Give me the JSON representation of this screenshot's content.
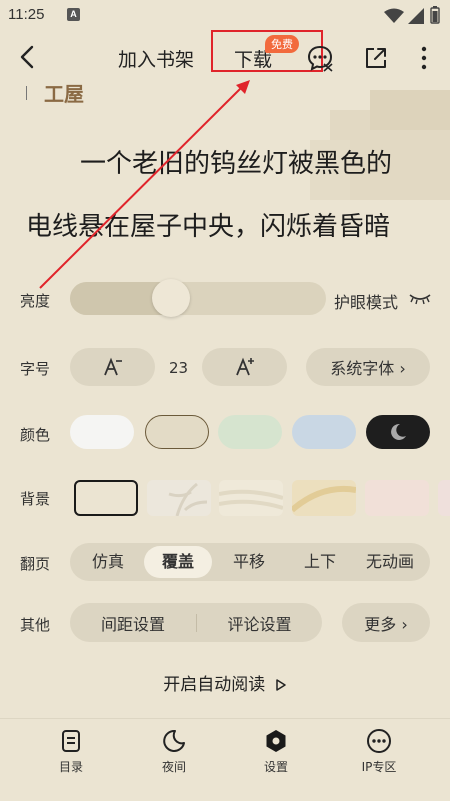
{
  "status_bar": {
    "time": "11:25",
    "notification_badge": "A"
  },
  "topbar": {
    "add_to_shelf_label": "加入书架",
    "download_label": "下载",
    "free_badge": "免费"
  },
  "reading": {
    "chapter_fragment": "工屋",
    "lines": [
      "一个老旧的钨丝灯被黑色的",
      "电线悬在屋子中央，闪烁着昏暗"
    ]
  },
  "settings": {
    "brightness": {
      "label": "亮度",
      "value": 0.4,
      "eye_mode_label": "护眼模式"
    },
    "font_size": {
      "label": "字号",
      "value": "23",
      "system_font_label": "系统字体 ›"
    },
    "color": {
      "label": "颜色",
      "options": [
        "#f5f5f3",
        "#e3dbc6",
        "#d6e4cf",
        "#c9d7e4",
        "#1e1e1e"
      ],
      "selected_index": 1
    },
    "background": {
      "label": "背景",
      "selected_index": 0
    },
    "page_turn": {
      "label": "翻页",
      "options": [
        "仿真",
        "覆盖",
        "平移",
        "上下",
        "无动画"
      ],
      "selected_index": 1
    },
    "other": {
      "label": "其他",
      "spacing_label": "间距设置",
      "comment_label": "评论设置",
      "more_label": "更多 ›"
    },
    "auto_read_label": "开启自动阅读"
  },
  "bottom_nav": {
    "items": [
      {
        "label": "目录",
        "icon": "catalog-icon"
      },
      {
        "label": "夜间",
        "icon": "moon-icon"
      },
      {
        "label": "设置",
        "icon": "settings-icon"
      },
      {
        "label": "IP专区",
        "icon": "more-dots-icon"
      }
    ]
  },
  "colors": {
    "background": "#ebe4d2",
    "accent_badge": "#f26a3d",
    "annotation_red": "#e0242b"
  }
}
